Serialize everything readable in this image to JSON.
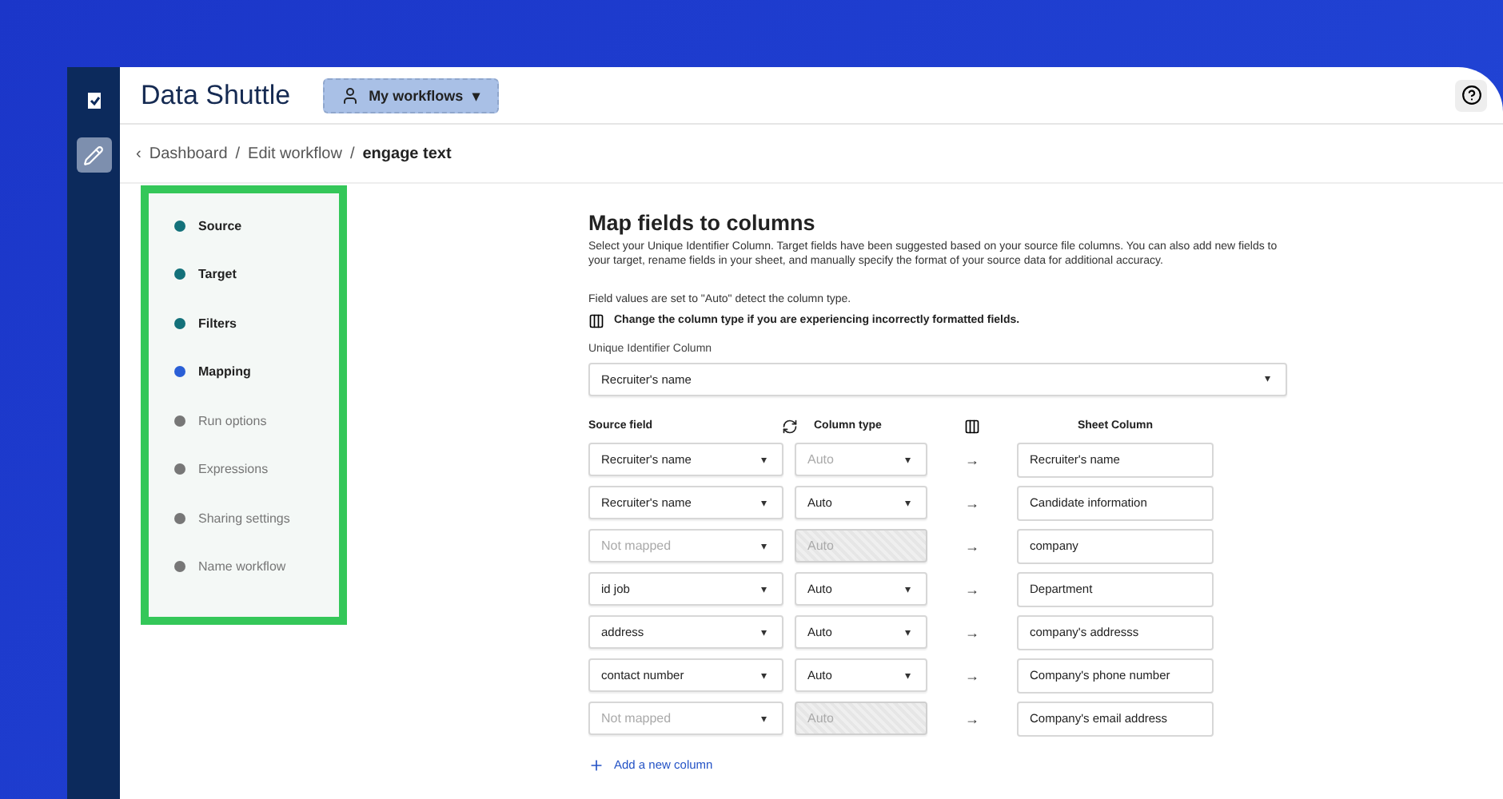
{
  "app": {
    "title": "Data Shuttle",
    "workflows_button": "My workflows",
    "caret": "▾"
  },
  "breadcrumb": {
    "back": "‹",
    "items": [
      {
        "label": "Dashboard",
        "current": false
      },
      {
        "label": "Edit workflow",
        "current": false
      },
      {
        "label": "engage text",
        "current": true
      }
    ],
    "separator": "/"
  },
  "steps": [
    {
      "label": "Source",
      "completed": true,
      "selected": false
    },
    {
      "label": "Target",
      "completed": true,
      "selected": false
    },
    {
      "label": "Filters",
      "completed": true,
      "selected": false
    },
    {
      "label": "Mapping",
      "completed": false,
      "selected": true
    },
    {
      "label": "Run options",
      "completed": false,
      "selected": false
    },
    {
      "label": "Expressions",
      "completed": false,
      "selected": false
    },
    {
      "label": "Sharing settings",
      "completed": false,
      "selected": false
    },
    {
      "label": "Name workflow",
      "completed": false,
      "selected": false
    }
  ],
  "main": {
    "title": "Map fields to columns",
    "description": "Select your Unique Identifier Column. Target fields have been suggested based on your source file columns. You can also add new fields to your target, rename fields in your sheet, and manually specify the format of your source data for additional accuracy.",
    "auto_note": "Field values are set to \"Auto\" detect the column type.",
    "tip": "Change the column type if you are experiencing incorrectly formatted fields.",
    "uid_label": "Unique Identifier Column",
    "uid_value": "Recruiter's name",
    "headers": {
      "source": "Source field",
      "type": "Column type",
      "sheet": "Sheet Column"
    },
    "rows": [
      {
        "source": {
          "value": "Recruiter's name"
        },
        "type": {
          "placeholder": "Auto",
          "disabled": false
        },
        "sheet": "Recruiter's name"
      },
      {
        "source": {
          "value": "Recruiter's name"
        },
        "type": {
          "value": "Auto",
          "disabled": false
        },
        "sheet": "Candidate information"
      },
      {
        "source": {
          "placeholder": "Not mapped"
        },
        "type": {
          "placeholder": "Auto",
          "disabled": true
        },
        "sheet": "company"
      },
      {
        "source": {
          "value": "id job"
        },
        "type": {
          "value": "Auto",
          "disabled": false
        },
        "sheet": "Department"
      },
      {
        "source": {
          "value": "address"
        },
        "type": {
          "value": "Auto",
          "disabled": false
        },
        "sheet": "company's addresss"
      },
      {
        "source": {
          "value": "contact number"
        },
        "type": {
          "value": "Auto",
          "disabled": false
        },
        "sheet": "Company's phone number"
      },
      {
        "source": {
          "placeholder": "Not mapped"
        },
        "type": {
          "placeholder": "Auto",
          "disabled": true
        },
        "sheet": "Company's email address"
      }
    ],
    "arrow": "→",
    "add_column": "Add a new column"
  }
}
